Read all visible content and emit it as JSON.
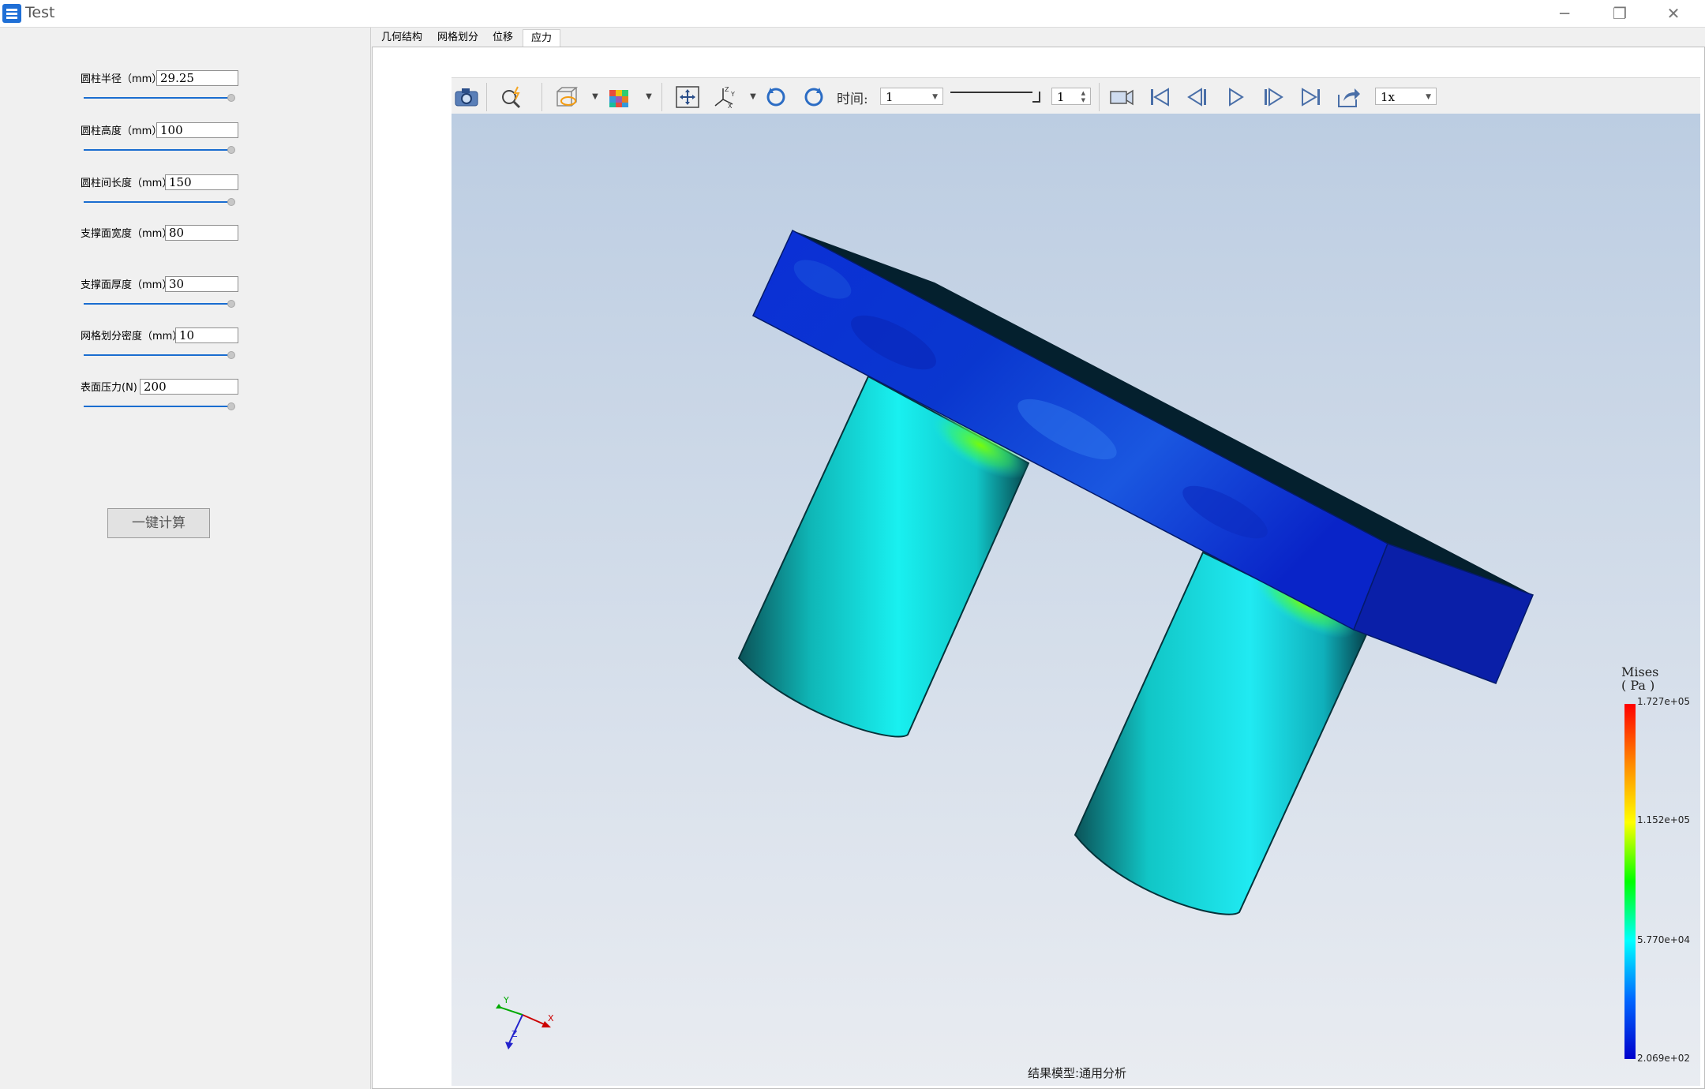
{
  "window": {
    "title": "Test",
    "minimize": "─",
    "restore": "❐",
    "close": "✕"
  },
  "params": [
    {
      "label": "圆柱半径（mm）",
      "value": "29.25",
      "slider": 1.0
    },
    {
      "label": "圆柱高度（mm）",
      "value": "100",
      "slider": 1.0
    },
    {
      "label": "圆柱间长度（mm）",
      "value": "150",
      "slider": 1.0
    },
    {
      "label": "支撑面宽度（mm）",
      "value": "80",
      "slider": null
    },
    {
      "label": "支撑面厚度（mm）",
      "value": "30",
      "slider": 1.0
    },
    {
      "label": "网格划分密度（mm）",
      "value": "10",
      "slider": 1.0
    },
    {
      "label": "表面压力(N)",
      "value": "200",
      "slider": 1.0
    }
  ],
  "calc_button": "一键计算",
  "tabs": [
    {
      "label": "几何结构",
      "active": false
    },
    {
      "label": "网格划分",
      "active": false
    },
    {
      "label": "位移",
      "active": false
    },
    {
      "label": "应力",
      "active": true
    }
  ],
  "toolbar": {
    "time_label": "时间:",
    "time_value": "1",
    "frame_value": "1",
    "speed_value": "1x"
  },
  "legend": {
    "title_line1": "Mises",
    "title_line2": "( Pa )",
    "values": [
      "1.727e+05",
      "1.152e+05",
      "5.770e+04",
      "2.069e+02"
    ],
    "colors": [
      "#ff0000",
      "#ffff00",
      "#00ff00",
      "#00ffff",
      "#0000cc"
    ]
  },
  "axes": {
    "y": "Y",
    "x": "X",
    "z": "Z"
  },
  "footer": "结果模型:通用分析"
}
